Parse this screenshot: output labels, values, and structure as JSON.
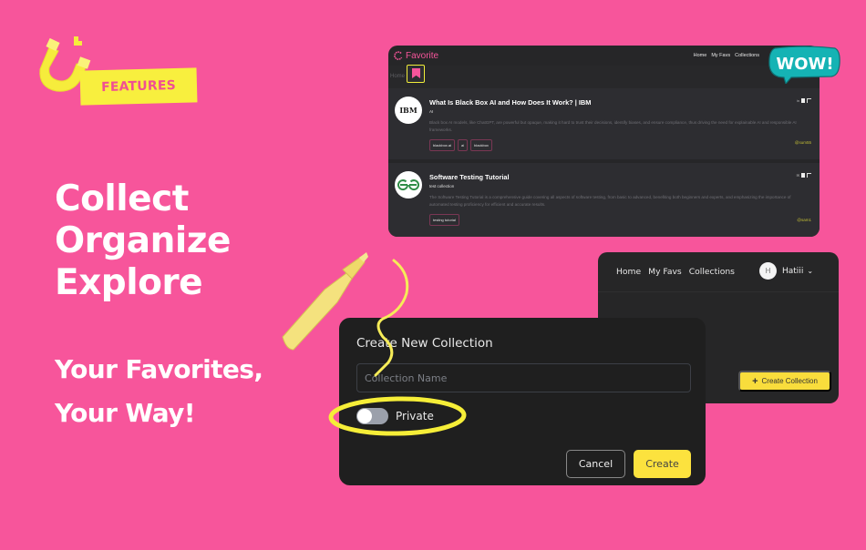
{
  "promo": {
    "badge_label": "FEATURES",
    "headline": [
      "Collect",
      "Organize",
      "Explore"
    ],
    "tagline": [
      "Your Favorites,",
      "Your Way!"
    ],
    "wow_label": "WOW!"
  },
  "colors": {
    "background": "#f7559b",
    "accent_yellow": "#fce23e",
    "panel_dark": "#262628",
    "brand_pink": "#f7559b"
  },
  "app_feed": {
    "brand": "Favorite",
    "nav_links": [
      "Home",
      "My Favs",
      "Collections"
    ],
    "breadcrumb": "Home",
    "cards": [
      {
        "logo_text": "IBM",
        "title": "What Is Black Box AI and How Does It Work? | IBM",
        "collection": "AI",
        "description": "Black box AI models, like ChatGPT, are powerful but opaque, making it hard to trust their decisions, identify biases, and ensure compliance, thus driving the need for explainable AI and responsible AI frameworks.",
        "tags": [
          "blackbox.ai",
          "ai",
          "blackbox"
        ],
        "user": "@sum55",
        "icons": [
          "linkedin-icon",
          "bookmark-icon",
          "flag-icon"
        ],
        "bookmarked": true
      },
      {
        "logo_text": "GG",
        "title": "Software Testing Tutorial",
        "collection": "test collection",
        "description": "The Software Testing Tutorial is a comprehensive guide covering all aspects of software testing, from basic to advanced, benefiting both beginners and experts, and emphasizing the importance of automated testing proficiency for efficient and accurate results.",
        "tags": [
          "testing tutorial"
        ],
        "user": "@sam1",
        "icons": [
          "mail-icon",
          "bookmark-icon",
          "flag-icon"
        ],
        "bookmarked": false
      }
    ]
  },
  "app_collections": {
    "nav_links": [
      "Home",
      "My Favs",
      "Collections"
    ],
    "user_initial": "H",
    "user_name": "Hatiii",
    "create_button": "Create Collection"
  },
  "modal": {
    "title": "Create New Collection",
    "name_placeholder": "Collection Name",
    "name_value": "",
    "private_label": "Private",
    "private_on": false,
    "cancel_label": "Cancel",
    "create_label": "Create"
  }
}
